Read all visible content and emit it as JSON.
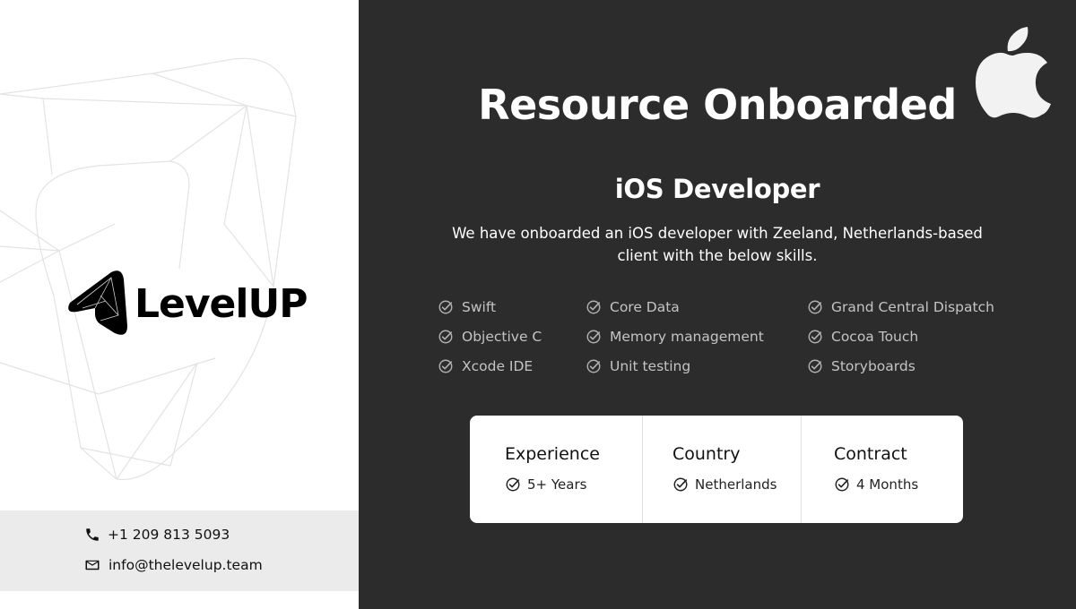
{
  "brand": {
    "name": "LevelUP"
  },
  "contact": {
    "phone": "+1 209 813 5093",
    "email": "info@thelevelup.team"
  },
  "heading": {
    "title": "Resource Onboarded",
    "role": "iOS Developer",
    "description": "We have onboarded an iOS developer with Zeeland, Netherlands-based client with the below skills."
  },
  "skills": {
    "column1": [
      "Swift",
      "Objective C",
      "Xcode IDE"
    ],
    "column2": [
      "Core Data",
      "Memory management",
      "Unit testing"
    ],
    "column3": [
      "Grand Central Dispatch",
      "Cocoa Touch",
      "Storyboards"
    ]
  },
  "details": [
    {
      "label": "Experience",
      "value": "5+ Years"
    },
    {
      "label": "Country",
      "value": "Netherlands"
    },
    {
      "label": "Contract",
      "value": "4 Months"
    }
  ],
  "colors": {
    "dark_panel": "#2c2c2c",
    "contact_band": "#ebebeb",
    "skill_text": "#c4c4c4"
  },
  "icons": [
    "phone-icon",
    "mail-icon",
    "apple-logo-icon",
    "check-circle-icon",
    "levelup-logo-icon"
  ]
}
